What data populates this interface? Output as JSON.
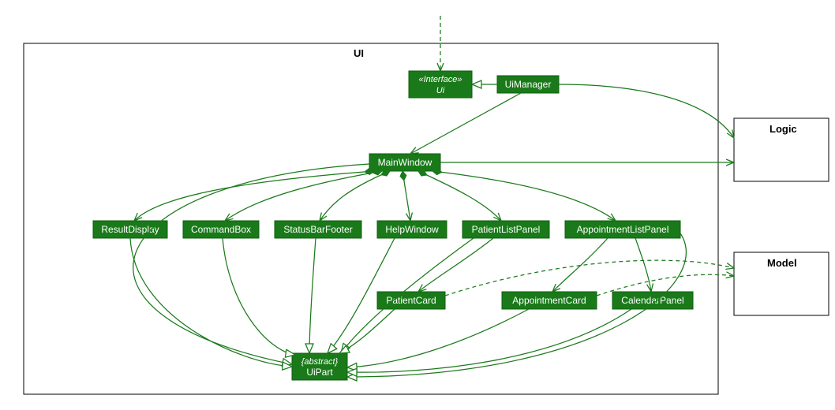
{
  "diagram_title": "UI",
  "packages": {
    "ui": {
      "title": "UI"
    },
    "logic": {
      "title": "Logic"
    },
    "model": {
      "title": "Model"
    }
  },
  "classes": {
    "interface_ui": {
      "stereotype": "«Interface»",
      "name": "Ui"
    },
    "uimanager": {
      "name": "UiManager"
    },
    "mainwindow": {
      "name": "MainWindow"
    },
    "resultdisplay": {
      "name": "ResultDisplay"
    },
    "commandbox": {
      "name": "CommandBox"
    },
    "statusbarfooter": {
      "name": "StatusBarFooter"
    },
    "helpwindow": {
      "name": "HelpWindow"
    },
    "patientlistpanel": {
      "name": "PatientListPanel"
    },
    "appointmentlistpanel": {
      "name": "AppointmentListPanel"
    },
    "patientcard": {
      "name": "PatientCard"
    },
    "appointmentcard": {
      "name": "AppointmentCard"
    },
    "calendarpanel": {
      "name": "CalendarPanel"
    },
    "uipart": {
      "stereotype": "{abstract}",
      "name": "UiPart"
    }
  },
  "chart_data": {
    "type": "uml_class_diagram",
    "packages": [
      "UI",
      "Logic",
      "Model"
    ],
    "classes_in_ui": [
      "Ui (interface)",
      "UiManager",
      "MainWindow",
      "ResultDisplay",
      "CommandBox",
      "StatusBarFooter",
      "HelpWindow",
      "PatientListPanel",
      "AppointmentListPanel",
      "PatientCard",
      "AppointmentCard",
      "CalendarPanel",
      "UiPart (abstract)"
    ],
    "relationships": [
      {
        "from": "(external)",
        "to": "Ui",
        "kind": "dependency_dashed_arrow"
      },
      {
        "from": "UiManager",
        "to": "Ui",
        "kind": "realization_open_triangle"
      },
      {
        "from": "UiManager",
        "to": "MainWindow",
        "kind": "association_arrow"
      },
      {
        "from": "UiManager",
        "to": "Logic",
        "kind": "association_arrow"
      },
      {
        "from": "MainWindow",
        "to": "Logic",
        "kind": "association_arrow"
      },
      {
        "from": "MainWindow",
        "to": "ResultDisplay",
        "kind": "composition_diamond"
      },
      {
        "from": "MainWindow",
        "to": "CommandBox",
        "kind": "composition_diamond"
      },
      {
        "from": "MainWindow",
        "to": "StatusBarFooter",
        "kind": "composition_diamond"
      },
      {
        "from": "MainWindow",
        "to": "HelpWindow",
        "kind": "composition_diamond"
      },
      {
        "from": "MainWindow",
        "to": "PatientListPanel",
        "kind": "composition_diamond"
      },
      {
        "from": "MainWindow",
        "to": "AppointmentListPanel",
        "kind": "composition_diamond"
      },
      {
        "from": "PatientListPanel",
        "to": "PatientCard",
        "kind": "association_arrow"
      },
      {
        "from": "AppointmentListPanel",
        "to": "AppointmentCard",
        "kind": "association_arrow"
      },
      {
        "from": "AppointmentListPanel",
        "to": "CalendarPanel",
        "kind": "association_arrow"
      },
      {
        "from": "PatientCard",
        "to": "Model",
        "kind": "dependency_dashed_arrow"
      },
      {
        "from": "AppointmentCard",
        "to": "Model",
        "kind": "dependency_dashed_arrow"
      },
      {
        "from": "MainWindow",
        "to": "UiPart",
        "kind": "generalization_open_triangle"
      },
      {
        "from": "ResultDisplay",
        "to": "UiPart",
        "kind": "generalization_open_triangle"
      },
      {
        "from": "CommandBox",
        "to": "UiPart",
        "kind": "generalization_open_triangle"
      },
      {
        "from": "StatusBarFooter",
        "to": "UiPart",
        "kind": "generalization_open_triangle"
      },
      {
        "from": "HelpWindow",
        "to": "UiPart",
        "kind": "generalization_open_triangle"
      },
      {
        "from": "PatientListPanel",
        "to": "UiPart",
        "kind": "generalization_open_triangle"
      },
      {
        "from": "AppointmentListPanel",
        "to": "UiPart",
        "kind": "generalization_open_triangle"
      },
      {
        "from": "PatientCard",
        "to": "UiPart",
        "kind": "generalization_open_triangle"
      },
      {
        "from": "AppointmentCard",
        "to": "UiPart",
        "kind": "generalization_open_triangle"
      },
      {
        "from": "CalendarPanel",
        "to": "UiPart",
        "kind": "generalization_open_triangle"
      }
    ]
  }
}
